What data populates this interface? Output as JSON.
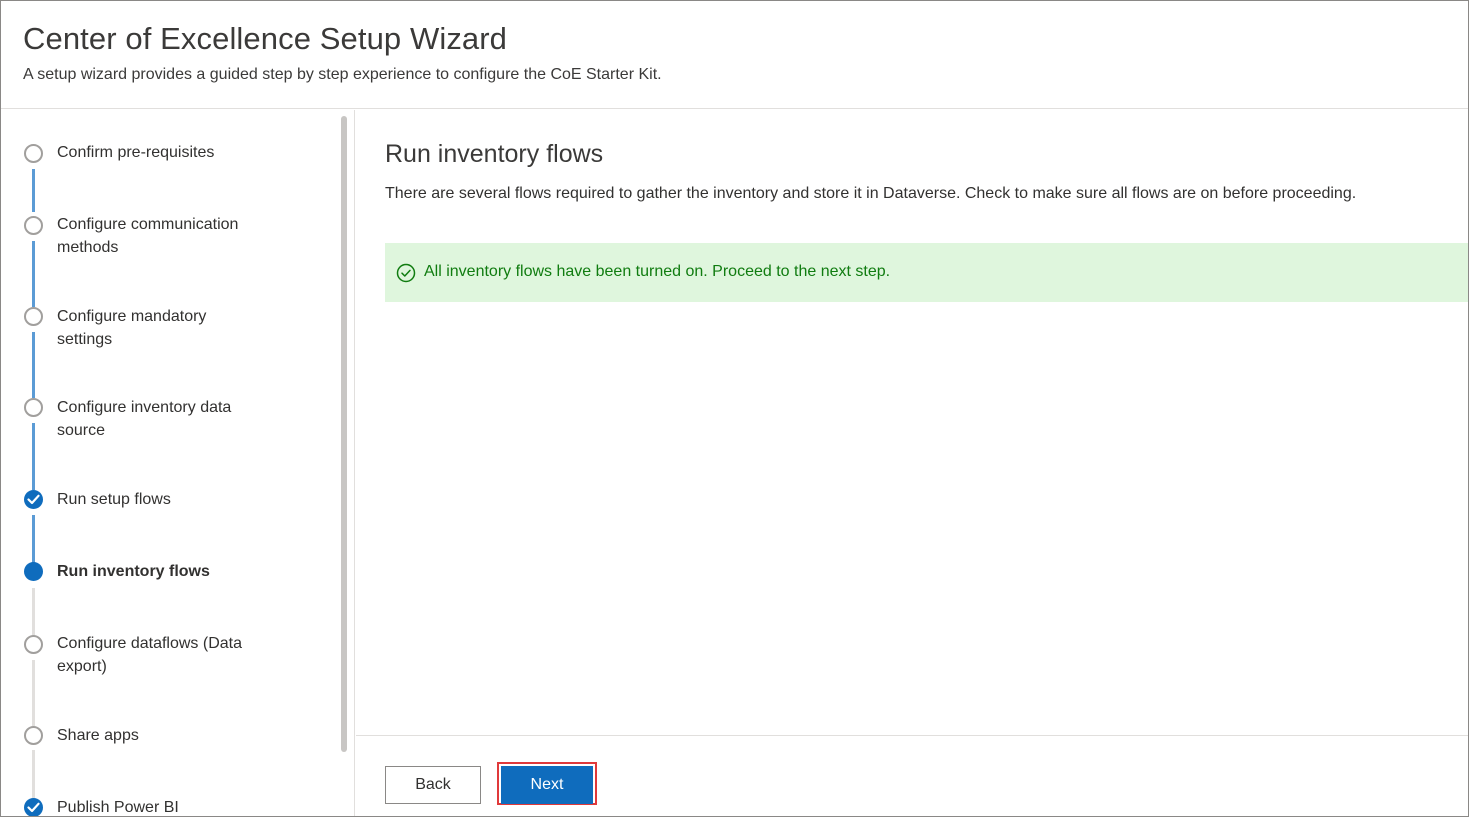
{
  "header": {
    "title": "Center of Excellence Setup Wizard",
    "subtitle": "A setup wizard provides a guided step by step experience to configure the CoE Starter Kit."
  },
  "steps": [
    {
      "label": "Confirm pre-requisites",
      "status": "pending"
    },
    {
      "label": "Configure communication methods",
      "status": "pending"
    },
    {
      "label": "Configure mandatory settings",
      "status": "pending"
    },
    {
      "label": "Configure inventory data source",
      "status": "pending"
    },
    {
      "label": "Run setup flows",
      "status": "completed"
    },
    {
      "label": "Run inventory flows",
      "status": "current"
    },
    {
      "label": "Configure dataflows (Data export)",
      "status": "pending"
    },
    {
      "label": "Share apps",
      "status": "pending"
    },
    {
      "label": "Publish Power BI",
      "status": "completed"
    }
  ],
  "main": {
    "title": "Run inventory flows",
    "description": "There are several flows required to gather the inventory and store it in Dataverse. Check to make sure all flows are on before proceeding.",
    "banner": {
      "icon": "check-circle-icon",
      "text": "All inventory flows have been turned on. Proceed to the next step."
    }
  },
  "footer": {
    "back_label": "Back",
    "next_label": "Next"
  },
  "colors": {
    "accent": "#0f6cbd",
    "success_bg": "#dff6dd",
    "success_text": "#107c10",
    "highlight_border": "#e0393b"
  }
}
